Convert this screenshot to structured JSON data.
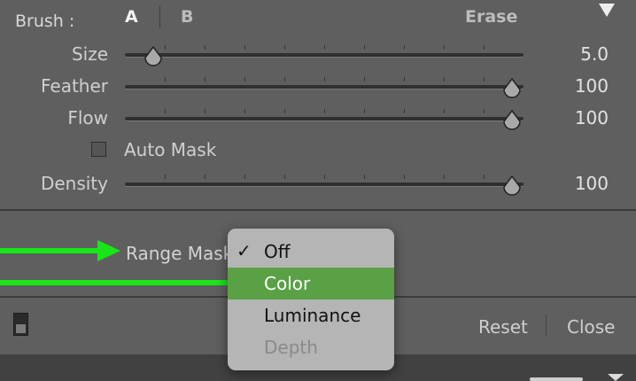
{
  "brush": {
    "label": "Brush :",
    "a": "A",
    "b": "B",
    "erase": "Erase"
  },
  "sliders": [
    {
      "label": "Size",
      "value": "5.0",
      "fraction": 0.07
    },
    {
      "label": "Feather",
      "value": "100",
      "fraction": 1.0
    },
    {
      "label": "Flow",
      "value": "100",
      "fraction": 1.0
    },
    {
      "label": "Density",
      "value": "100",
      "fraction": 1.0
    }
  ],
  "auto_mask": {
    "label": "Auto Mask",
    "checked": false
  },
  "range_mask": {
    "label": "Range Mask"
  },
  "menu": {
    "items": [
      {
        "label": "Off",
        "checked": true,
        "check": "✓"
      },
      {
        "label": "Color",
        "highlighted": true
      },
      {
        "label": "Luminance"
      },
      {
        "label": "Depth",
        "disabled": true
      }
    ]
  },
  "footer": {
    "reset": "Reset",
    "close": "Close"
  },
  "colors": {
    "arrow": "#19e619",
    "highlight": "#5aa146",
    "panel": "#5f5f5f",
    "menu": "#b5b5b5"
  }
}
